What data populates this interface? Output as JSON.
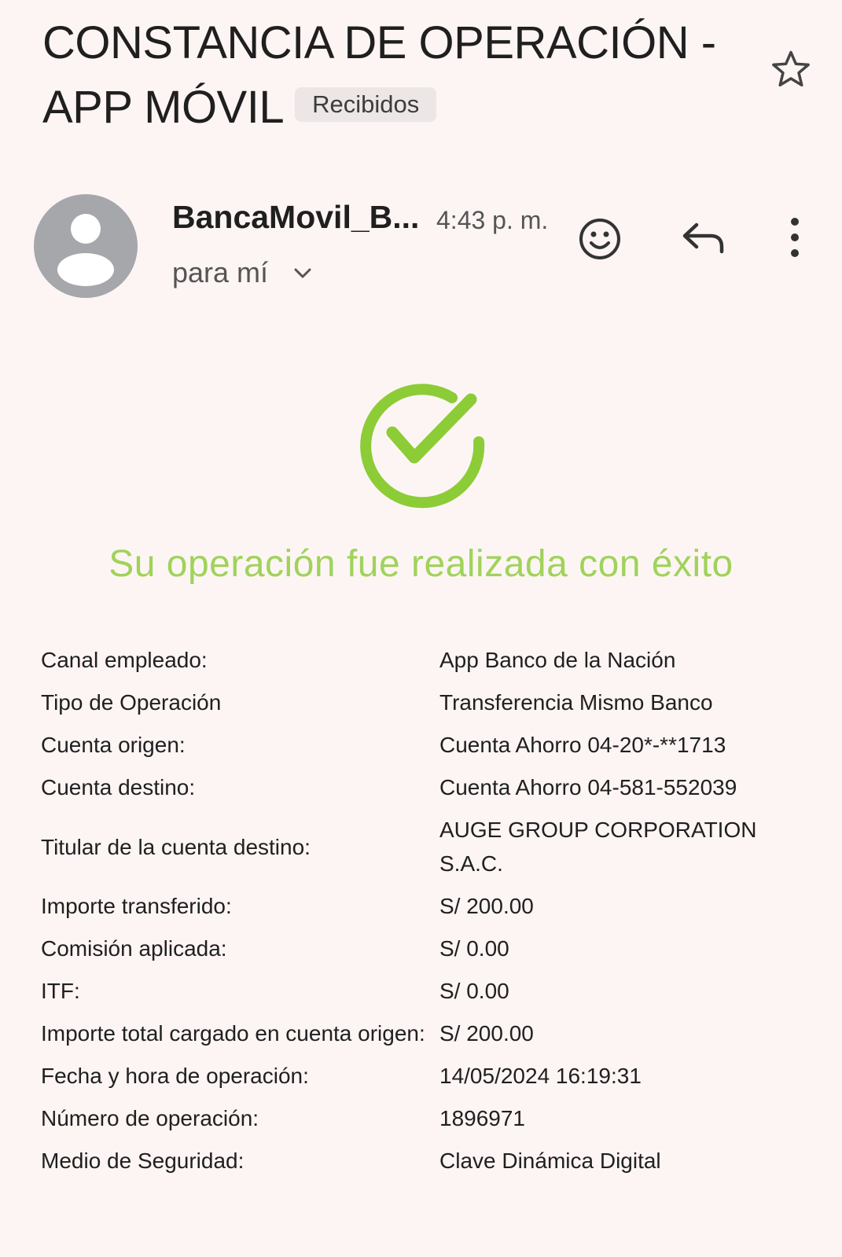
{
  "email": {
    "subject": "CONSTANCIA DE OPERACIÓN - APP MÓVIL",
    "label": "Recibidos",
    "sender": "BancaMovil_B...",
    "time": "4:43 p. m.",
    "recipient": "para mí"
  },
  "icons": {
    "star": "star-outline-icon",
    "avatar": "person-icon",
    "emoji": "smiley-icon",
    "reply": "reply-arrow-icon",
    "more": "vertical-ellipsis-icon",
    "expand": "chevron-down-icon",
    "success": "check-circle-icon"
  },
  "colors": {
    "background": "#fdf5f4",
    "success_green": "#9fd35a",
    "avatar_gray": "#a5a7ab",
    "chip_bg": "#ece6e6"
  },
  "receipt": {
    "success_message": "Su operación fue realizada con éxito",
    "rows": [
      {
        "key": "Canal empleado:",
        "value": "App Banco de la Nación"
      },
      {
        "key": "Tipo de Operación",
        "value": "Transferencia Mismo Banco"
      },
      {
        "key": "Cuenta origen:",
        "value": "Cuenta Ahorro 04-20*-**1713"
      },
      {
        "key": "Cuenta destino:",
        "value": "Cuenta Ahorro 04-581-552039"
      },
      {
        "key": "Titular de la cuenta destino:",
        "value": "AUGE GROUP CORPORATION S.A.C."
      },
      {
        "key": "Importe transferido:",
        "value": "S/ 200.00"
      },
      {
        "key": "Comisión aplicada:",
        "value": "S/ 0.00"
      },
      {
        "key": "ITF:",
        "value": "S/ 0.00"
      },
      {
        "key": "Importe total cargado en cuenta origen:",
        "value": "S/ 200.00"
      },
      {
        "key": "Fecha y hora de operación:",
        "value": "14/05/2024 16:19:31"
      },
      {
        "key": "Número de operación:",
        "value": "1896971"
      },
      {
        "key": "Medio de Seguridad:",
        "value": "Clave Dinámica Digital"
      }
    ]
  }
}
